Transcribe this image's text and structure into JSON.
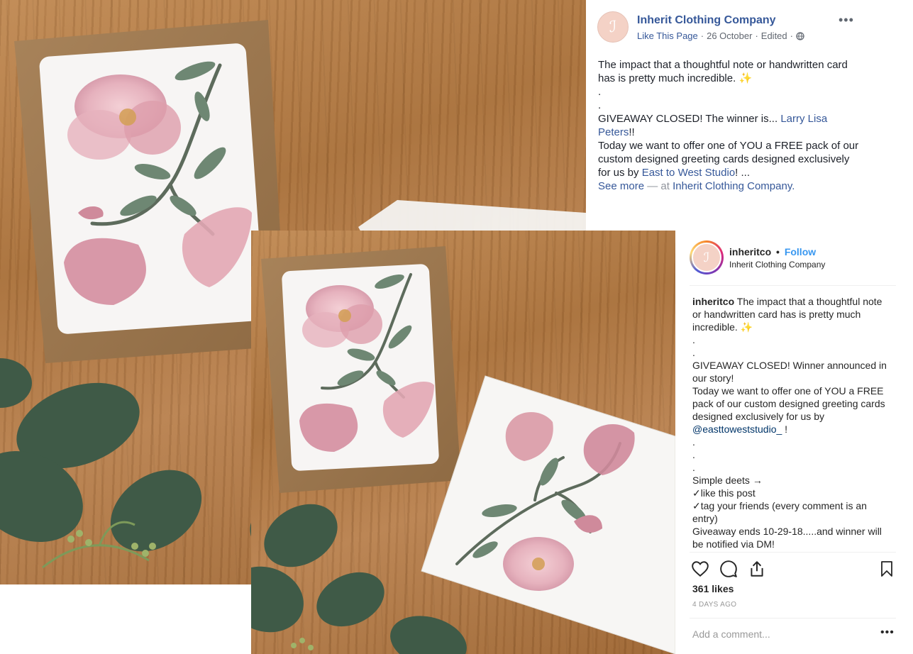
{
  "facebook": {
    "page_name": "Inherit Clothing Company",
    "avatar_glyph": "ℐ",
    "like_label": "Like This Page",
    "separator": "·",
    "date": "26 October",
    "edited": "Edited",
    "more_label": "•••",
    "post": {
      "line1_a": "The impact that a thoughtful note or handwritten card has is pretty much incredible.",
      "sparkle": "✨",
      "dot1": ".",
      "dot2": ".",
      "giveaway_prefix": "GIVEAWAY CLOSED! The winner is... ",
      "winner_name": "Larry Lisa Peters",
      "winner_suffix": "!!",
      "offer_prefix": "Today we want to offer one of YOU a FREE pack of our custom designed greeting cards designed exclusively for us by ",
      "studio_link": "East to West Studio",
      "offer_suffix": "! ...",
      "see_more": "See more",
      "at_text": " — at ",
      "location_link": "Inherit Clothing Company."
    }
  },
  "instagram": {
    "username": "inheritco",
    "dot": "•",
    "follow_label": "Follow",
    "subtitle": "Inherit Clothing Company",
    "avatar_glyph": "ℐ",
    "caption": {
      "username": "inheritco",
      "line1": " The impact that a thoughtful note or handwritten card has is pretty much incredible. ",
      "sparkle": "✨",
      "dots_a": [
        ".",
        "."
      ],
      "giveaway": "GIVEAWAY CLOSED! Winner announced in our story!",
      "offer": "Today we want to offer one of YOU a FREE pack of our custom designed greeting cards designed exclusively for us by",
      "mention": "@easttoweststudio_",
      "mention_suffix": " !",
      "dots_b": [
        ".",
        ".",
        "."
      ],
      "deets": "Simple deets →",
      "rule1": "✓like this post",
      "rule2": "✓tag your friends (every comment is an entry)",
      "ends": "Giveaway ends 10-29-18.....and winner will be notified via DM!"
    },
    "likes": "361 likes",
    "time_ago": "4 DAYS AGO",
    "comment_placeholder": "Add a comment...",
    "comment_more": "•••",
    "icons": [
      "heart-icon",
      "comment-icon",
      "share-icon",
      "bookmark-icon"
    ]
  },
  "colors": {
    "fb_link": "#365899",
    "ig_follow": "#3897f0",
    "petal": "#d99aa6",
    "leaf": "#6f8a72",
    "kraft": "#a07a4f"
  }
}
